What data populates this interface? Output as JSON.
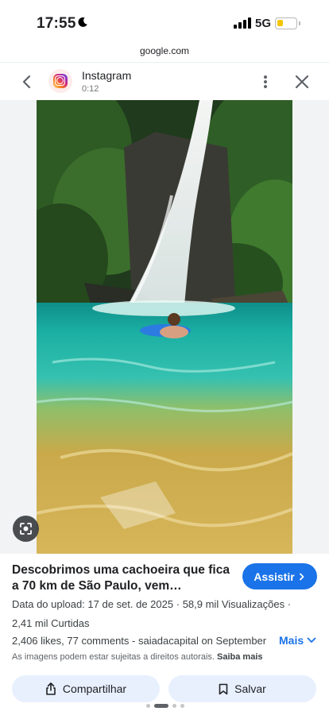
{
  "status_bar": {
    "time": "17:55",
    "network": "5G",
    "battery_level": 0.3
  },
  "browser": {
    "url": "google.com"
  },
  "header": {
    "source_name": "Instagram",
    "duration": "0:12"
  },
  "result": {
    "title": "Descobrimos uma cachoeira que fica a 70 km de São Paulo, vem conhecer…",
    "visit_label": "Assistir",
    "upload_label": "Data do upload: 17 de set. de 2025",
    "views": "58,9 mil Visualizações",
    "likes_count": "2,41 mil Curtidas",
    "description": "2,406 likes, 77 comments - saiadacapital on September",
    "more_label": "Mais",
    "rights_notice": "As imagens podem estar sujeitas a direitos autorais.",
    "learn_more": "Saiba mais"
  },
  "actions": {
    "share_label": "Compartilhar",
    "save_label": "Salvar"
  },
  "pagination": {
    "total": 4,
    "active": 2
  },
  "colors": {
    "accent": "#1a73e8",
    "chip": "#e8f0fe",
    "water": "#1fae9e"
  }
}
